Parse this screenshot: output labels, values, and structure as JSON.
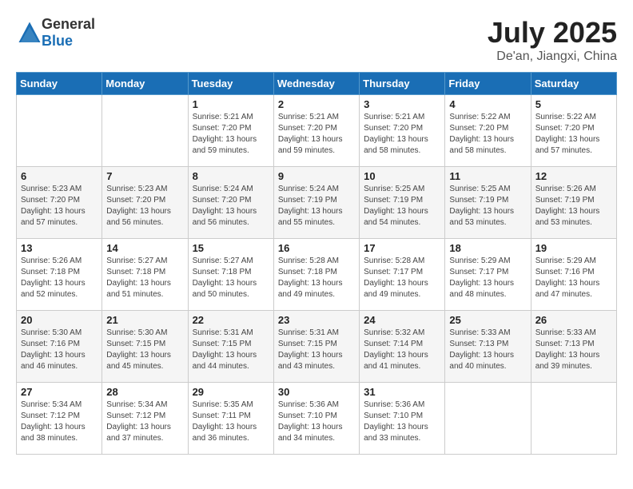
{
  "header": {
    "logo_general": "General",
    "logo_blue": "Blue",
    "month_year": "July 2025",
    "location": "De'an, Jiangxi, China"
  },
  "weekdays": [
    "Sunday",
    "Monday",
    "Tuesday",
    "Wednesday",
    "Thursday",
    "Friday",
    "Saturday"
  ],
  "weeks": [
    [
      {
        "day": "",
        "sunrise": "",
        "sunset": "",
        "daylight": ""
      },
      {
        "day": "",
        "sunrise": "",
        "sunset": "",
        "daylight": ""
      },
      {
        "day": "1",
        "sunrise": "Sunrise: 5:21 AM",
        "sunset": "Sunset: 7:20 PM",
        "daylight": "Daylight: 13 hours and 59 minutes."
      },
      {
        "day": "2",
        "sunrise": "Sunrise: 5:21 AM",
        "sunset": "Sunset: 7:20 PM",
        "daylight": "Daylight: 13 hours and 59 minutes."
      },
      {
        "day": "3",
        "sunrise": "Sunrise: 5:21 AM",
        "sunset": "Sunset: 7:20 PM",
        "daylight": "Daylight: 13 hours and 58 minutes."
      },
      {
        "day": "4",
        "sunrise": "Sunrise: 5:22 AM",
        "sunset": "Sunset: 7:20 PM",
        "daylight": "Daylight: 13 hours and 58 minutes."
      },
      {
        "day": "5",
        "sunrise": "Sunrise: 5:22 AM",
        "sunset": "Sunset: 7:20 PM",
        "daylight": "Daylight: 13 hours and 57 minutes."
      }
    ],
    [
      {
        "day": "6",
        "sunrise": "Sunrise: 5:23 AM",
        "sunset": "Sunset: 7:20 PM",
        "daylight": "Daylight: 13 hours and 57 minutes."
      },
      {
        "day": "7",
        "sunrise": "Sunrise: 5:23 AM",
        "sunset": "Sunset: 7:20 PM",
        "daylight": "Daylight: 13 hours and 56 minutes."
      },
      {
        "day": "8",
        "sunrise": "Sunrise: 5:24 AM",
        "sunset": "Sunset: 7:20 PM",
        "daylight": "Daylight: 13 hours and 56 minutes."
      },
      {
        "day": "9",
        "sunrise": "Sunrise: 5:24 AM",
        "sunset": "Sunset: 7:19 PM",
        "daylight": "Daylight: 13 hours and 55 minutes."
      },
      {
        "day": "10",
        "sunrise": "Sunrise: 5:25 AM",
        "sunset": "Sunset: 7:19 PM",
        "daylight": "Daylight: 13 hours and 54 minutes."
      },
      {
        "day": "11",
        "sunrise": "Sunrise: 5:25 AM",
        "sunset": "Sunset: 7:19 PM",
        "daylight": "Daylight: 13 hours and 53 minutes."
      },
      {
        "day": "12",
        "sunrise": "Sunrise: 5:26 AM",
        "sunset": "Sunset: 7:19 PM",
        "daylight": "Daylight: 13 hours and 53 minutes."
      }
    ],
    [
      {
        "day": "13",
        "sunrise": "Sunrise: 5:26 AM",
        "sunset": "Sunset: 7:18 PM",
        "daylight": "Daylight: 13 hours and 52 minutes."
      },
      {
        "day": "14",
        "sunrise": "Sunrise: 5:27 AM",
        "sunset": "Sunset: 7:18 PM",
        "daylight": "Daylight: 13 hours and 51 minutes."
      },
      {
        "day": "15",
        "sunrise": "Sunrise: 5:27 AM",
        "sunset": "Sunset: 7:18 PM",
        "daylight": "Daylight: 13 hours and 50 minutes."
      },
      {
        "day": "16",
        "sunrise": "Sunrise: 5:28 AM",
        "sunset": "Sunset: 7:18 PM",
        "daylight": "Daylight: 13 hours and 49 minutes."
      },
      {
        "day": "17",
        "sunrise": "Sunrise: 5:28 AM",
        "sunset": "Sunset: 7:17 PM",
        "daylight": "Daylight: 13 hours and 49 minutes."
      },
      {
        "day": "18",
        "sunrise": "Sunrise: 5:29 AM",
        "sunset": "Sunset: 7:17 PM",
        "daylight": "Daylight: 13 hours and 48 minutes."
      },
      {
        "day": "19",
        "sunrise": "Sunrise: 5:29 AM",
        "sunset": "Sunset: 7:16 PM",
        "daylight": "Daylight: 13 hours and 47 minutes."
      }
    ],
    [
      {
        "day": "20",
        "sunrise": "Sunrise: 5:30 AM",
        "sunset": "Sunset: 7:16 PM",
        "daylight": "Daylight: 13 hours and 46 minutes."
      },
      {
        "day": "21",
        "sunrise": "Sunrise: 5:30 AM",
        "sunset": "Sunset: 7:15 PM",
        "daylight": "Daylight: 13 hours and 45 minutes."
      },
      {
        "day": "22",
        "sunrise": "Sunrise: 5:31 AM",
        "sunset": "Sunset: 7:15 PM",
        "daylight": "Daylight: 13 hours and 44 minutes."
      },
      {
        "day": "23",
        "sunrise": "Sunrise: 5:31 AM",
        "sunset": "Sunset: 7:15 PM",
        "daylight": "Daylight: 13 hours and 43 minutes."
      },
      {
        "day": "24",
        "sunrise": "Sunrise: 5:32 AM",
        "sunset": "Sunset: 7:14 PM",
        "daylight": "Daylight: 13 hours and 41 minutes."
      },
      {
        "day": "25",
        "sunrise": "Sunrise: 5:33 AM",
        "sunset": "Sunset: 7:13 PM",
        "daylight": "Daylight: 13 hours and 40 minutes."
      },
      {
        "day": "26",
        "sunrise": "Sunrise: 5:33 AM",
        "sunset": "Sunset: 7:13 PM",
        "daylight": "Daylight: 13 hours and 39 minutes."
      }
    ],
    [
      {
        "day": "27",
        "sunrise": "Sunrise: 5:34 AM",
        "sunset": "Sunset: 7:12 PM",
        "daylight": "Daylight: 13 hours and 38 minutes."
      },
      {
        "day": "28",
        "sunrise": "Sunrise: 5:34 AM",
        "sunset": "Sunset: 7:12 PM",
        "daylight": "Daylight: 13 hours and 37 minutes."
      },
      {
        "day": "29",
        "sunrise": "Sunrise: 5:35 AM",
        "sunset": "Sunset: 7:11 PM",
        "daylight": "Daylight: 13 hours and 36 minutes."
      },
      {
        "day": "30",
        "sunrise": "Sunrise: 5:36 AM",
        "sunset": "Sunset: 7:10 PM",
        "daylight": "Daylight: 13 hours and 34 minutes."
      },
      {
        "day": "31",
        "sunrise": "Sunrise: 5:36 AM",
        "sunset": "Sunset: 7:10 PM",
        "daylight": "Daylight: 13 hours and 33 minutes."
      },
      {
        "day": "",
        "sunrise": "",
        "sunset": "",
        "daylight": ""
      },
      {
        "day": "",
        "sunrise": "",
        "sunset": "",
        "daylight": ""
      }
    ]
  ]
}
